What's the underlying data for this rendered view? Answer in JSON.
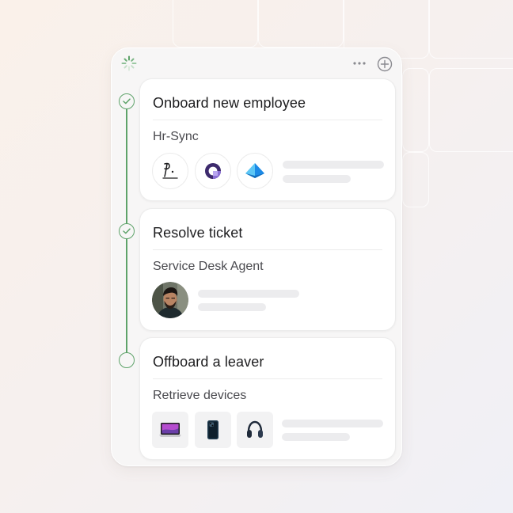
{
  "workflow": {
    "steps": [
      {
        "title": "Onboard new employee",
        "subtitle": "Hr-Sync",
        "status": "completed",
        "items": [
          "signature-app-icon",
          "purple-ring-app-icon",
          "azure-pyramid-app-icon"
        ]
      },
      {
        "title": "Resolve ticket",
        "subtitle": "Service Desk Agent",
        "status": "completed",
        "items": [
          "agent-avatar"
        ]
      },
      {
        "title": "Offboard a leaver",
        "subtitle": "Retrieve devices",
        "status": "pending",
        "items": [
          "laptop-icon",
          "smartphone-icon",
          "headphones-icon"
        ]
      }
    ]
  },
  "colors": {
    "accent_green": "#5ea36a",
    "card_bg": "#ffffff",
    "panel_bg": "#f7f6f6",
    "skeleton": "#ececee"
  }
}
